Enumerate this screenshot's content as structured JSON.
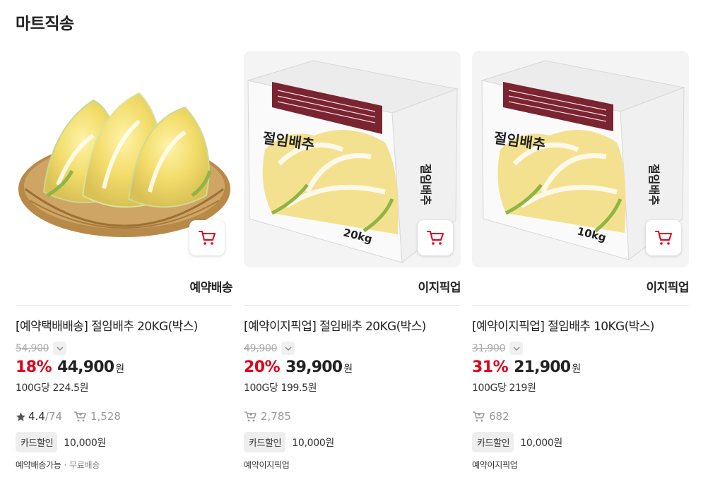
{
  "section": {
    "title": "마트직송"
  },
  "products": [
    {
      "delivery_type": "예약배송",
      "name": "[예약택배배송] 절임배추 20KG(박스)",
      "original_price": "54,900",
      "discount_rate": "18%",
      "price": "44,900",
      "currency": "원",
      "unit_price": "100G당 224.5원",
      "rating": "4.4",
      "reviews": "/74",
      "buyers": "1,528",
      "card_badge": "카드할인",
      "card_discount": "10,000원",
      "footer": "예약배송가능",
      "footer_sep": "·",
      "footer_extra": "무료배송",
      "image": "napa-cabbage-basket"
    },
    {
      "delivery_type": "이지픽업",
      "name": "[예약이지픽업] 절임배추 20KG(박스)",
      "original_price": "49,900",
      "discount_rate": "20%",
      "price": "39,900",
      "currency": "원",
      "unit_price": "100G당 199.5원",
      "buyers": "2,785",
      "card_badge": "카드할인",
      "card_discount": "10,000원",
      "footer": "예약이지픽업",
      "box_brand": "절임배추",
      "box_weight": "20kg",
      "image": "cabbage-box-20kg"
    },
    {
      "delivery_type": "이지픽업",
      "name": "[예약이지픽업] 절임배추 10KG(박스)",
      "original_price": "31,900",
      "discount_rate": "31%",
      "price": "21,900",
      "currency": "원",
      "unit_price": "100G당 219원",
      "buyers": "682",
      "card_badge": "카드할인",
      "card_discount": "10,000원",
      "footer": "예약이지픽업",
      "box_brand": "절임배추",
      "box_weight": "10kg",
      "image": "cabbage-box-10kg"
    }
  ],
  "icons": {
    "cart": "cart-icon",
    "chevron": "chevron-down-icon",
    "star": "star-icon",
    "buyers": "buyers-cart-icon"
  },
  "colors": {
    "accent": "#e0001b",
    "text": "#222222",
    "muted": "#999999"
  }
}
